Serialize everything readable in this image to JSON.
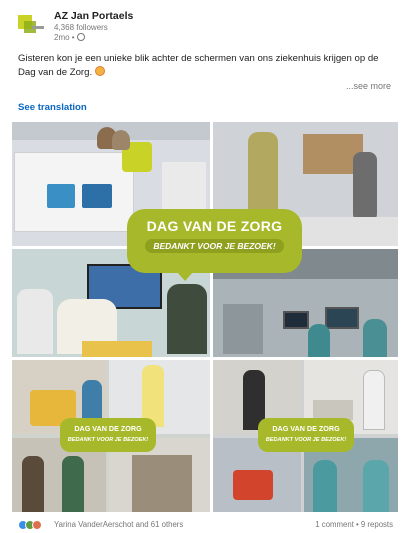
{
  "post": {
    "author": "AZ Jan Portaels",
    "followers": "4,368 followers",
    "age": "2mo •",
    "text": "Gisteren kon je een unieke blik achter de schermen van ons ziekenhuis krijgen op de Dag van de Zorg.",
    "see_more": "...see more",
    "see_translation": "See translation"
  },
  "image": {
    "banner_title": "DAG VAN DE ZORG",
    "banner_subtitle": "BEDANKT VOOR JE BEZOEK!"
  },
  "social": {
    "reactions": "Yarina VanderAerschot and 61 others",
    "comments_reposts": "1 comment • 9 reposts"
  },
  "colors": {
    "accent_green": "#a7b92a",
    "link_blue": "#0a66c2"
  },
  "icons": [
    "globe-icon",
    "party-emoji-icon",
    "like-reaction-icon",
    "celebrate-reaction-icon",
    "love-reaction-icon"
  ]
}
